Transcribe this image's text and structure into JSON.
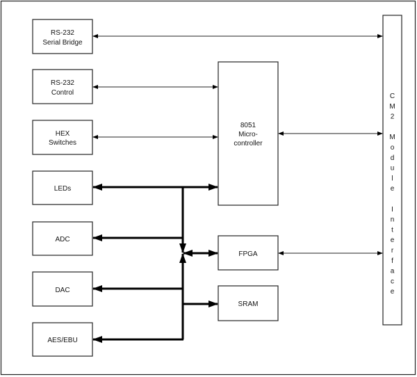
{
  "diagram": {
    "blocks": {
      "rs232_bridge": [
        "RS-232",
        "Serial Bridge"
      ],
      "rs232_control": [
        "RS-232",
        "Control"
      ],
      "hex": [
        "HEX",
        "Switches"
      ],
      "leds": "LEDs",
      "adc": "ADC",
      "dac": "DAC",
      "aes": "AES/EBU",
      "mcu": [
        "8051",
        "Micro-",
        "controller"
      ],
      "fpga": "FPGA",
      "sram": "SRAM",
      "cm2": [
        "C",
        "M",
        "2",
        "",
        "M",
        "o",
        "d",
        "u",
        "l",
        "e",
        "",
        "I",
        "n",
        "t",
        "e",
        "r",
        "f",
        "a",
        "c",
        "e"
      ]
    }
  }
}
